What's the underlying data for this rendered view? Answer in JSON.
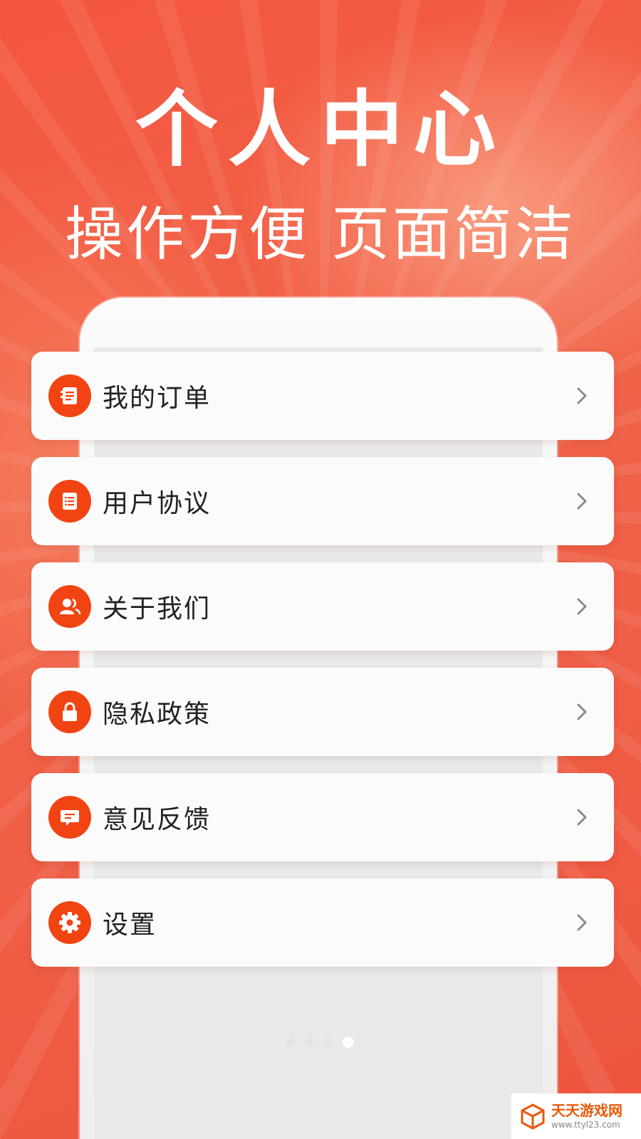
{
  "hero": {
    "title": "个人中心",
    "subtitle": "操作方便 页面简洁"
  },
  "menu": [
    {
      "label": "我的订单",
      "icon": "order-list-icon"
    },
    {
      "label": "用户协议",
      "icon": "agreement-list-icon"
    },
    {
      "label": "关于我们",
      "icon": "users-icon"
    },
    {
      "label": "隐私政策",
      "icon": "lock-icon"
    },
    {
      "label": "意见反馈",
      "icon": "message-icon"
    },
    {
      "label": "设置",
      "icon": "gear-icon"
    }
  ],
  "pager": {
    "count": 4,
    "active_index": 3
  },
  "watermark": {
    "title": "天天游戏网",
    "url": "www.ttyl23.com"
  },
  "colors": {
    "background": "#f2553e",
    "accent": "#f24412",
    "card": "#fbfbfb",
    "text": "#222222"
  }
}
